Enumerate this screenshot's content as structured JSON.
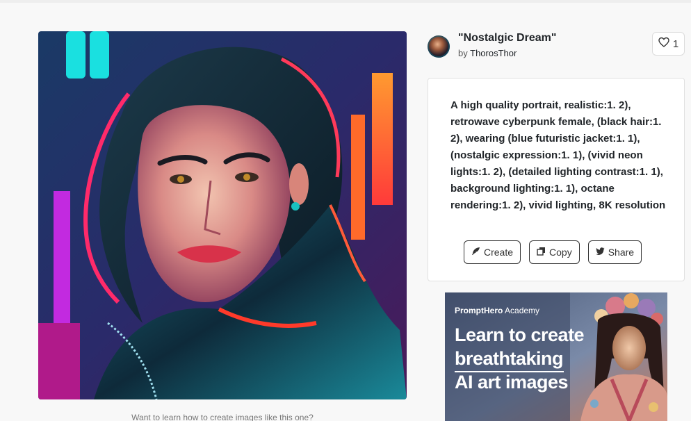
{
  "post": {
    "title": "\"Nostalgic Dream\"",
    "by_label": "by",
    "author": "ThorosThor",
    "likes": "1"
  },
  "prompt": {
    "text": "A high quality portrait, realistic:1. 2), retrowave cyberpunk female, (black hair:1. 2), wearing (blue futuristic jacket:1. 1), (nostalgic expression:1. 1), (vivid neon lights:1. 2), (detailed lighting contrast:1. 1), background lighting:1. 1), octane rendering:1. 2), vivid lighting, 8K resolution"
  },
  "actions": {
    "create": "Create",
    "copy": "Copy",
    "share": "Share"
  },
  "learn_more": "Want to learn how to create images like this one?",
  "ad": {
    "brand_bold": "PromptHero",
    "brand_rest": " Academy",
    "line1": "Learn to create",
    "line2": "breathtaking",
    "line3": "AI art images"
  },
  "icons": {
    "like": "heart-icon",
    "create": "feather-icon",
    "copy": "copy-icon",
    "share": "twitter-icon"
  },
  "colors": {
    "accent": "#212529",
    "background": "#f8f8f8",
    "card": "#ffffff"
  }
}
